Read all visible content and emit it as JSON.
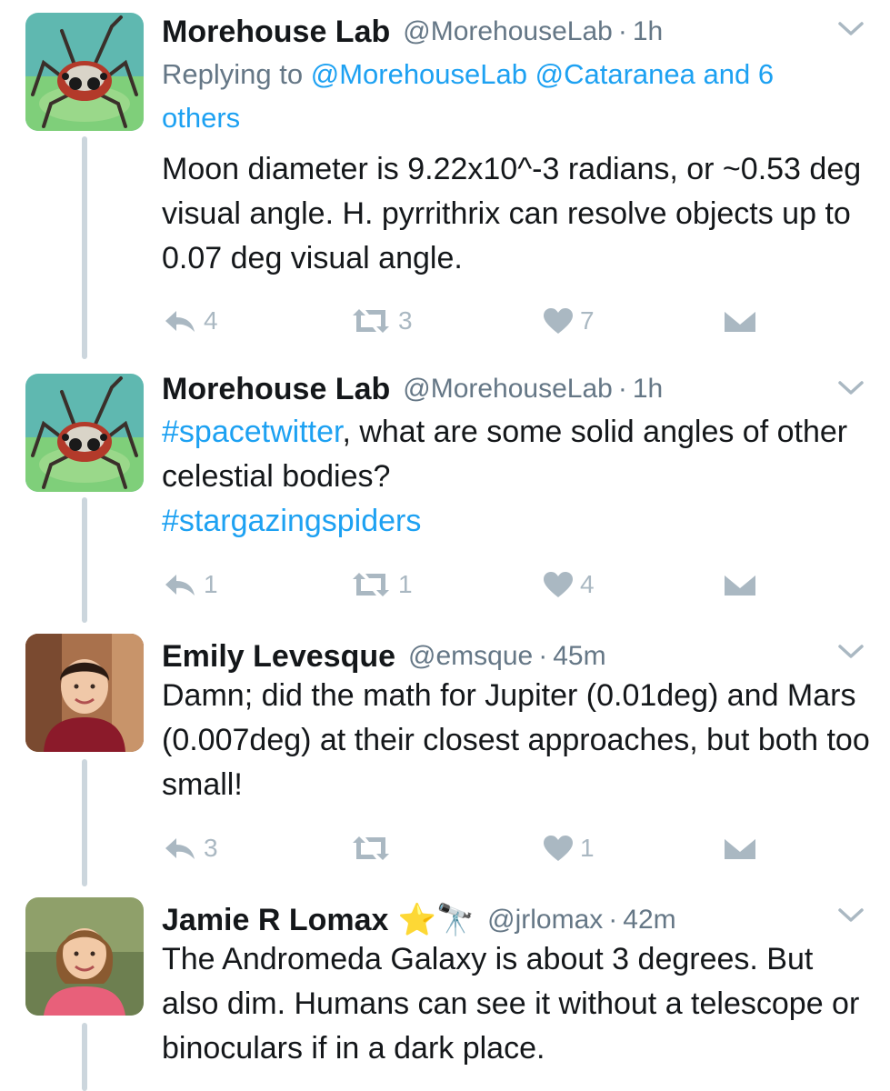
{
  "tweets": [
    {
      "name": "Morehouse Lab",
      "handle": "@MorehouseLab",
      "time": "1h",
      "reply_label": "Replying to",
      "reply_mentions": "@MorehouseLab @Cataranea",
      "reply_others": "and 6 others",
      "text": "Moon diameter is 9.22x10^-3 radians, or ~0.53 deg visual angle. H. pyrrithrix can resolve objects up to 0.07 deg visual angle.",
      "replies": "4",
      "retweets": "3",
      "likes": "7"
    },
    {
      "name": "Morehouse Lab",
      "handle": "@MorehouseLab",
      "time": "1h",
      "hashtag1": "#spacetwitter",
      "text": ", what are some solid angles of other celestial bodies?",
      "hashtag2": "#stargazingspiders",
      "replies": "1",
      "retweets": "1",
      "likes": "4"
    },
    {
      "name": "Emily Levesque",
      "handle": "@emsque",
      "time": "45m",
      "text": "Damn; did the math for Jupiter (0.01deg) and Mars (0.007deg) at their closest approaches, but both too small!",
      "replies": "3",
      "retweets": "",
      "likes": "1"
    },
    {
      "name": "Jamie R Lomax",
      "name_emoji": "⭐🔭",
      "handle": "@jrlomax",
      "time": "42m",
      "text": "The Andromeda Galaxy is about 3 degrees. But also dim. Humans can see it without a telescope or binoculars if in a dark place."
    }
  ],
  "separator": "·",
  "colors": {
    "link": "#1da1f2",
    "muted": "#657786",
    "icon": "#aab8c2",
    "thread_line": "#ccd6dd"
  },
  "icons": [
    "reply-icon",
    "retweet-icon",
    "like-icon",
    "dm-icon",
    "chevron-down-icon",
    "spider-avatar",
    "person-avatar"
  ]
}
